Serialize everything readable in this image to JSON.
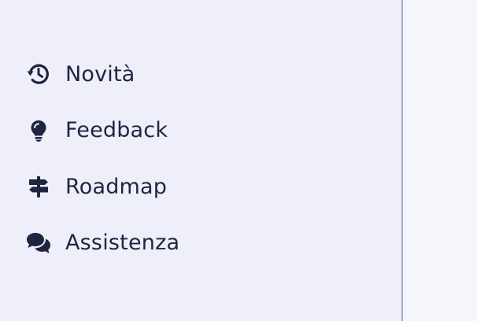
{
  "sidebar": {
    "items": [
      {
        "label": "Novità",
        "icon": "history-icon"
      },
      {
        "label": "Feedback",
        "icon": "lightbulb-icon"
      },
      {
        "label": "Roadmap",
        "icon": "signpost-icon"
      },
      {
        "label": "Assistenza",
        "icon": "chat-bubbles-icon"
      }
    ]
  },
  "colors": {
    "sidebar_bg": "#eeeff8",
    "content_bg": "#f5f6fa",
    "divider": "#a9aecb",
    "text": "#1f2540"
  }
}
